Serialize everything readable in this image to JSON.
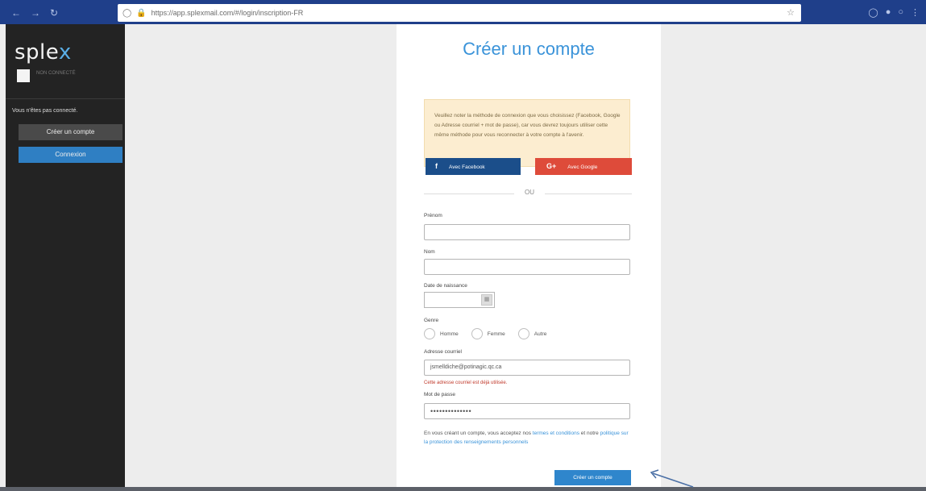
{
  "browser": {
    "nav_icons": [
      "back-icon",
      "forward-icon",
      "reload-icon"
    ],
    "url": "https://app.splexmail.com/#/login/inscription-FR",
    "right_icons": [
      "shield-icon",
      "extension-icon",
      "sync-icon",
      "menu-icon"
    ]
  },
  "sidebar": {
    "logo_main": "sple",
    "logo_accent": "x",
    "avatar_text": "NON CONNECTÉ",
    "status": "Vous n'êtes pas connecté.",
    "create_label": "Créer un compte",
    "login_label": "Connexion"
  },
  "form": {
    "title": "Créer un compte",
    "notice": "Veuillez noter la méthode de connexion que vous choisissez (Facebook, Google ou Adresse courriel + mot de passe), car vous devrez toujours utiliser cette même méthode pour vous reconnecter à votre compte à l'avenir.",
    "facebook_label": "Avec Facebook",
    "google_label": "Avec Google",
    "or_text": "OU",
    "prenom_label": "Prénom",
    "prenom_value": "",
    "nom_label": "Nom",
    "nom_value": "",
    "birth_label": "Date de naissance",
    "gender_label": "Genre",
    "gender_options": [
      "Homme",
      "Femme",
      "Autre"
    ],
    "email_label": "Adresse courriel",
    "email_value": "jsmelldiche@potinagic.qc.ca",
    "email_error": "Cette adresse courriel est déjà utilisée.",
    "password_label": "Mot de passe",
    "password_value": "••••••••••••••",
    "terms_prefix": "En vous créant un compte, vous acceptez nos ",
    "terms_link1": "termes et conditions",
    "terms_mid": " et notre ",
    "terms_link2": "politique sur la protection des renseignements personnels",
    "submit_label": "Créer un compte"
  }
}
